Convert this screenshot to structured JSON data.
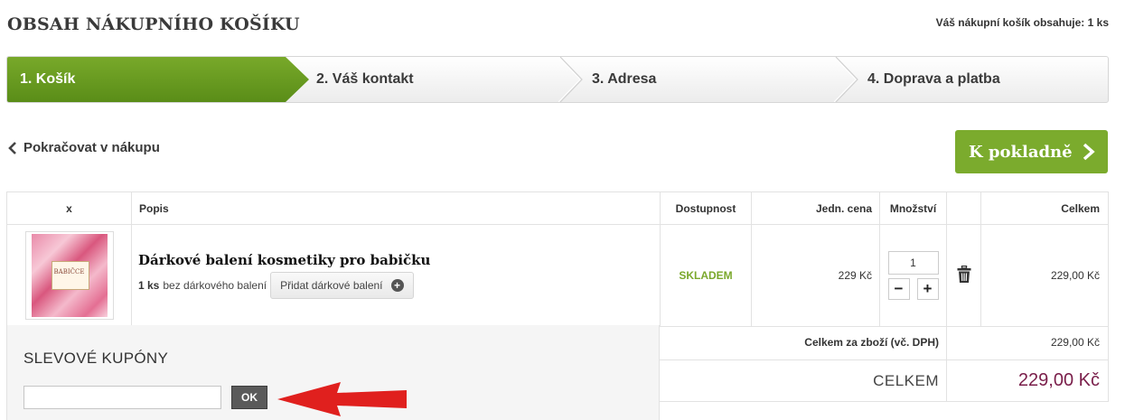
{
  "header": {
    "title": "OBSAH NÁKUPNÍHO KOŠÍKU",
    "cart_count": "Váš nákupní košík obsahuje: 1 ks"
  },
  "steps": [
    {
      "label": "1. Košík",
      "active": true
    },
    {
      "label": "2. Váš kontakt",
      "active": false
    },
    {
      "label": "3. Adresa",
      "active": false
    },
    {
      "label": "4. Doprava a platba",
      "active": false
    }
  ],
  "nav": {
    "continue_label": "Pokračovat v nákupu",
    "checkout_label": "K pokladně"
  },
  "table": {
    "headers": {
      "x": "x",
      "description": "Popis",
      "availability": "Dostupnost",
      "unit_price": "Jedn. cena",
      "quantity": "Množství",
      "total": "Celkem"
    },
    "items": [
      {
        "thumbnail_text": "BABIČCE",
        "name": "Dárkové balení kosmetiky pro babičku",
        "quantity_label": "1 ks",
        "gift_status": "bez dárkového balení",
        "gift_button": "Přidat dárkové balení",
        "availability": "SKLADEM",
        "unit_price": "229 Kč",
        "quantity": "1",
        "line_total": "229,00 Kč"
      }
    ]
  },
  "coupons": {
    "title": "SLEVOVÉ KUPÓNY",
    "input_value": "",
    "ok_label": "OK"
  },
  "summary": {
    "goods_total_label": "Celkem za zboží (vč. DPH)",
    "goods_total_value": "229,00 Kč",
    "grand_total_label": "CELKEM",
    "grand_total_value": "229,00 Kč"
  },
  "colors": {
    "accent_green": "#7bab2d",
    "stock_green": "#7ba82d",
    "total_color": "#7a1e4a",
    "annotation_arrow": "#e0201e"
  }
}
